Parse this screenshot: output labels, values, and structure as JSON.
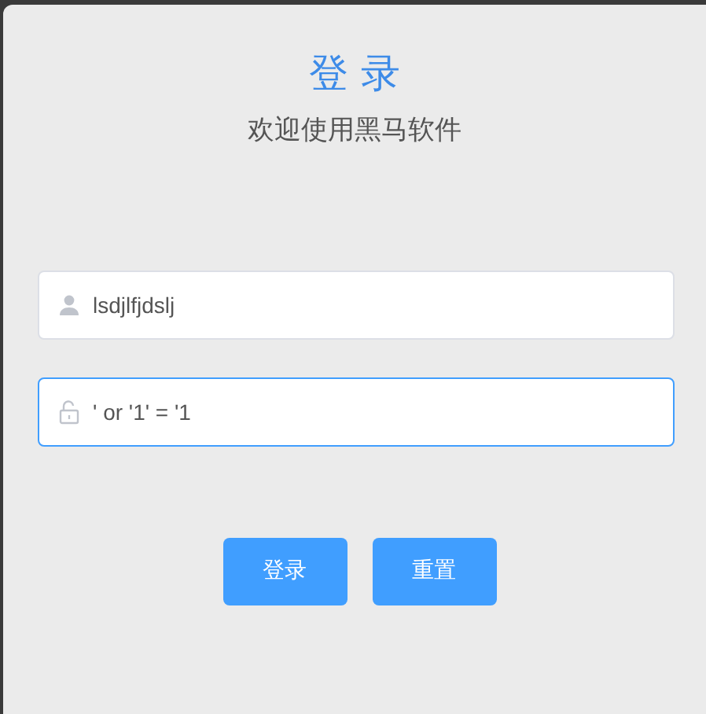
{
  "title": "登 录",
  "subtitle": "欢迎使用黑马软件",
  "fields": [
    {
      "kind": "user",
      "value": "lsdjlfjdslj",
      "focused": false
    },
    {
      "kind": "lock",
      "value": "' or '1' = '1",
      "focused": true
    }
  ],
  "buttons": [
    "登录",
    "重置"
  ]
}
